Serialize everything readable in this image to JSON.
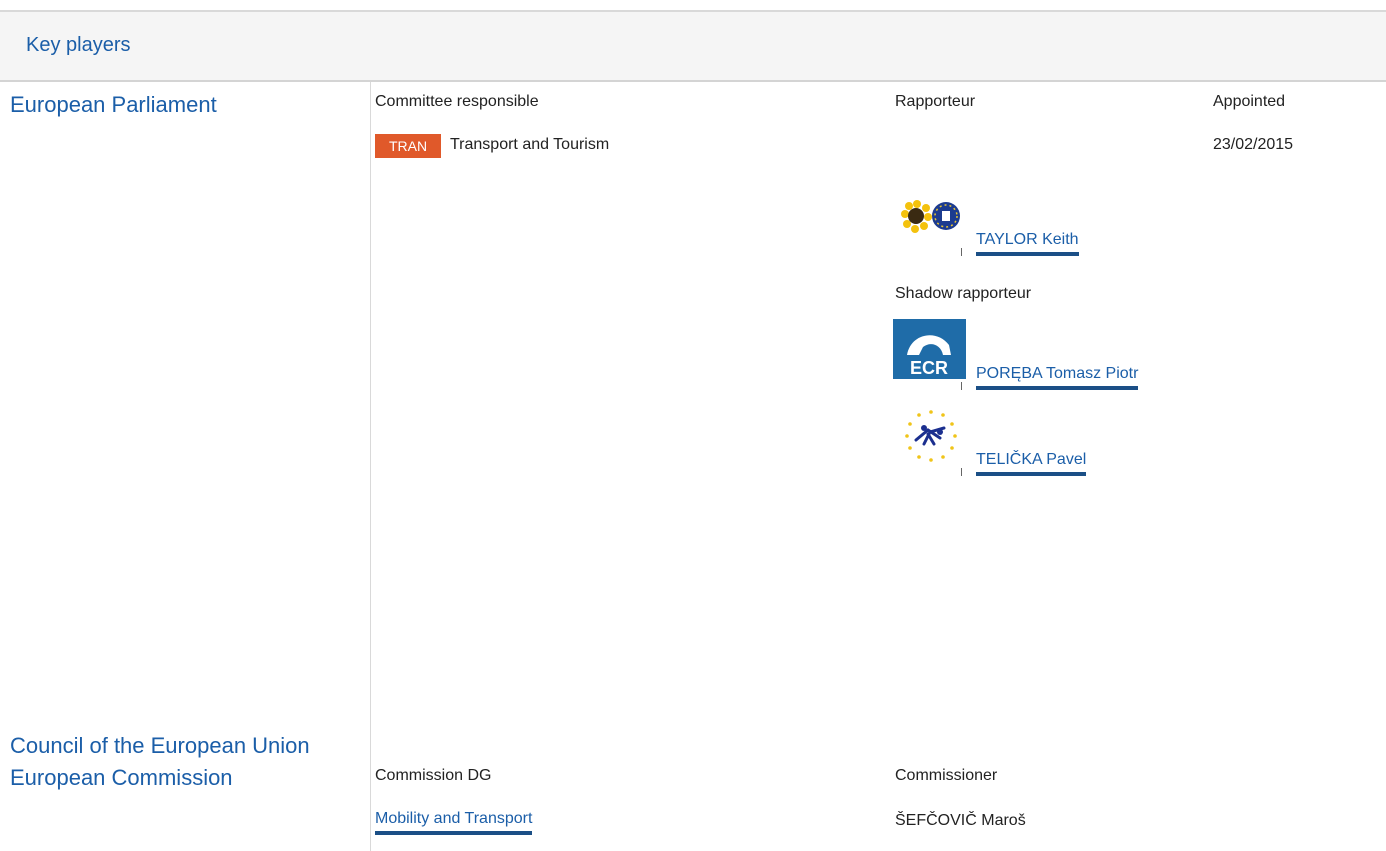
{
  "section_title": "Key players",
  "european_parliament": {
    "name": "European Parliament",
    "committee_header": "Committee responsible",
    "rapporteur_header": "Rapporteur",
    "appointed_header": "Appointed",
    "committee_code": "TRAN",
    "committee_name": "Transport and Tourism",
    "appointed_date": "23/02/2015",
    "rapporteur": {
      "name": "TAYLOR Keith",
      "group_logo": "greens-efa-logo"
    },
    "shadow_header": "Shadow rapporteur",
    "shadows": [
      {
        "name": "PORĘBA Tomasz Piotr",
        "group_logo": "ecr-logo",
        "group_logo_text": "ECR"
      },
      {
        "name": "TELIČKA Pavel",
        "group_logo": "alde-logo"
      }
    ]
  },
  "council": {
    "name": "Council of the European Union"
  },
  "commission": {
    "name": "European Commission",
    "dg_header": "Commission DG",
    "commissioner_header": "Commissioner",
    "dg_name": "Mobility and Transport",
    "commissioner_name": "ŠEFČOVIČ Maroš"
  },
  "colors": {
    "link": "#1b5ea8",
    "badge": "#e0592a",
    "header_bg": "#f5f5f5"
  }
}
